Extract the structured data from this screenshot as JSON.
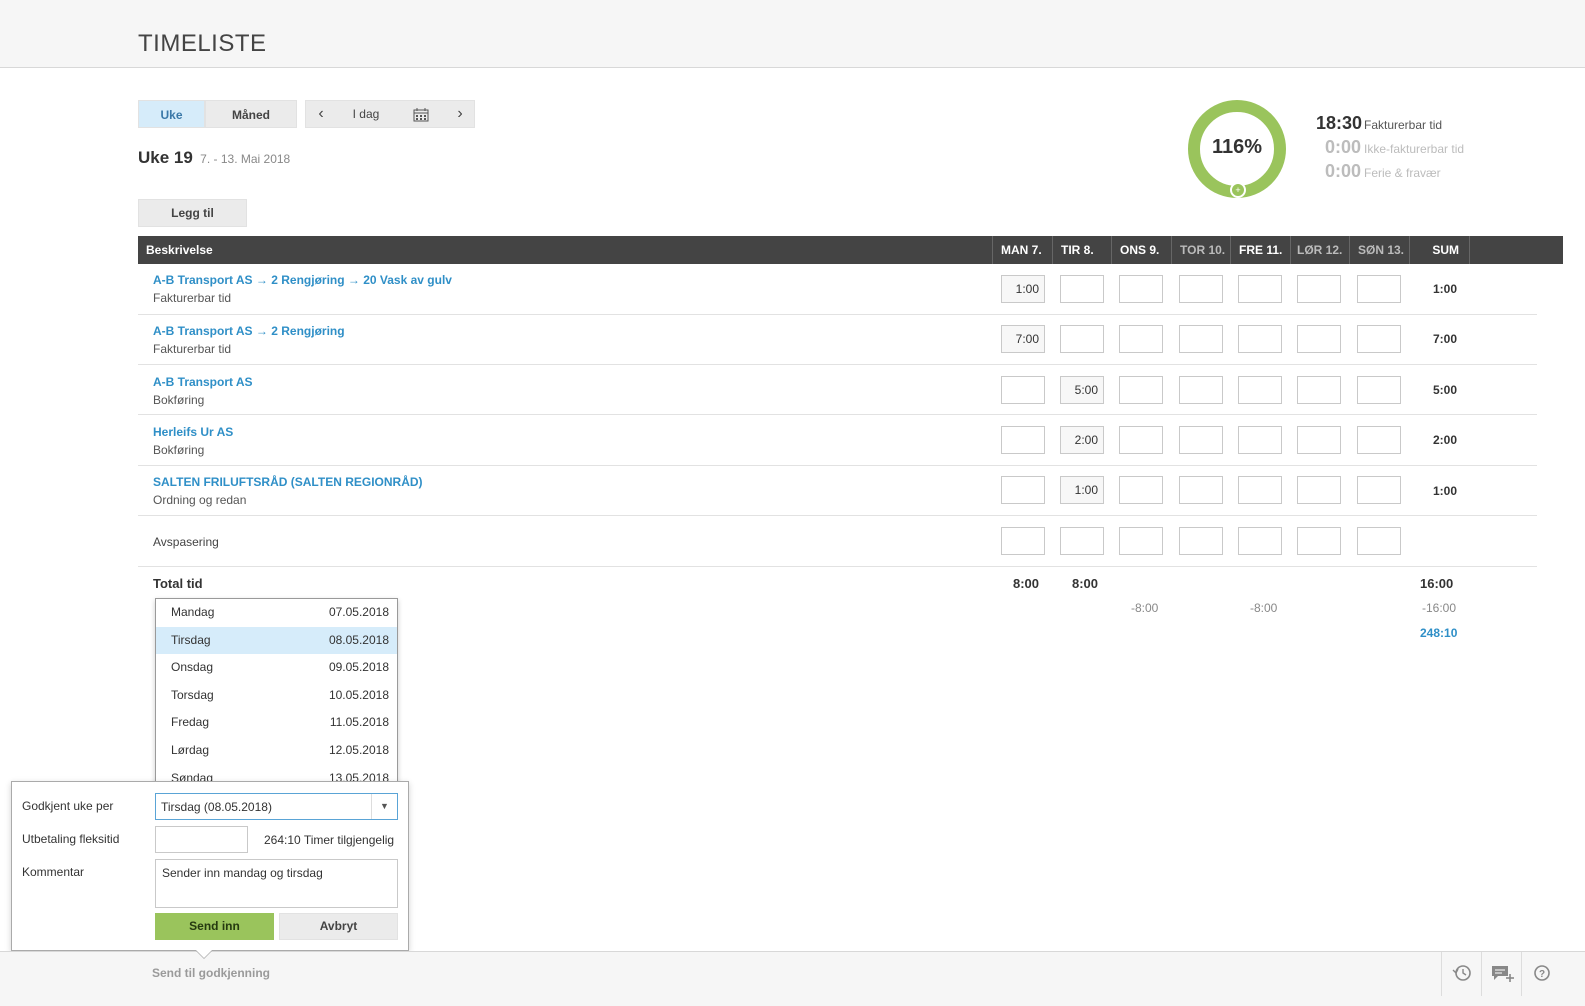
{
  "app": {
    "title": "TIMELISTE"
  },
  "view_toggle": {
    "week": "Uke",
    "month": "Måned"
  },
  "nav": {
    "prev": "‹",
    "today": "I dag",
    "next": "›"
  },
  "week": {
    "title": "Uke 19",
    "range": "7. - 13. Mai 2018"
  },
  "add_button": "Legg til",
  "summary": {
    "percent": "116%",
    "percent_value": 116,
    "items": [
      {
        "value": "18:30",
        "label": "Fakturerbar tid"
      },
      {
        "value": "0:00",
        "label": "Ikke-fakturerbar tid"
      },
      {
        "value": "0:00",
        "label": "Ferie & fravær"
      }
    ],
    "colors": {
      "ring": "#9ac45c",
      "muted": "#bcbcbc"
    }
  },
  "table": {
    "header": {
      "description": "Beskrivelse",
      "days": [
        "MAN 7.",
        "TIR 8.",
        "ONS 9.",
        "TOR 10.",
        "FRE 11.",
        "LØR 12.",
        "SØN 13."
      ],
      "sum": "SUM"
    },
    "rows": [
      {
        "title": "A-B Transport AS → 2 Rengjøring → 20 Vask av gulv",
        "sub": "Fakturerbar tid",
        "hours": [
          "1:00",
          "",
          "",
          "",
          "",
          "",
          ""
        ],
        "sum": "1:00"
      },
      {
        "title": "A-B Transport AS → 2 Rengjøring",
        "sub": "Fakturerbar tid",
        "hours": [
          "7:00",
          "",
          "",
          "",
          "",
          "",
          ""
        ],
        "sum": "7:00"
      },
      {
        "title": "A-B Transport AS",
        "sub": "Bokføring",
        "hours": [
          "",
          "5:00",
          "",
          "",
          "",
          "",
          ""
        ],
        "sum": "5:00"
      },
      {
        "title": "Herleifs Ur AS",
        "sub": "Bokføring",
        "hours": [
          "",
          "2:00",
          "",
          "",
          "",
          "",
          ""
        ],
        "sum": "2:00"
      },
      {
        "title": "SALTEN FRILUFTSRÅD (SALTEN REGIONRÅD)",
        "sub": "Ordning og redan",
        "hours": [
          "",
          "1:00",
          "",
          "",
          "",
          "",
          ""
        ],
        "sum": "1:00"
      }
    ],
    "avspasering": "Avspasering",
    "total": {
      "label": "Total tid",
      "mon": "8:00",
      "tue": "8:00",
      "sum": "16:00"
    },
    "diff": {
      "wed": "-8:00",
      "fri": "-8:00",
      "sum": "-16:00"
    },
    "flex_balance": "248:10"
  },
  "day_dropdown": {
    "options": [
      {
        "day": "Mandag",
        "date": "07.05.2018"
      },
      {
        "day": "Tirsdag",
        "date": "08.05.2018"
      },
      {
        "day": "Onsdag",
        "date": "09.05.2018"
      },
      {
        "day": "Torsdag",
        "date": "10.05.2018"
      },
      {
        "day": "Fredag",
        "date": "11.05.2018"
      },
      {
        "day": "Lørdag",
        "date": "12.05.2018"
      },
      {
        "day": "Søndag",
        "date": "13.05.2018"
      }
    ],
    "selected_index": 1
  },
  "approval": {
    "approved_label": "Godkjent uke per",
    "approved_value": "Tirsdag (08.05.2018)",
    "flex_label": "Utbetaling fleksitid",
    "flex_value": "",
    "flex_available": "264:10",
    "flex_available_label": "Timer tilgjengelig",
    "comment_label": "Kommentar",
    "comment_value": "Sender inn mandag og tirsdag",
    "send": "Send inn",
    "cancel": "Avbryt"
  },
  "bottom": {
    "send_for_approval": "Send til godkjenning"
  },
  "icons": {
    "history": "history-icon",
    "comment": "comment-add-icon",
    "help": "help-icon",
    "calendar": "calendar-icon"
  }
}
